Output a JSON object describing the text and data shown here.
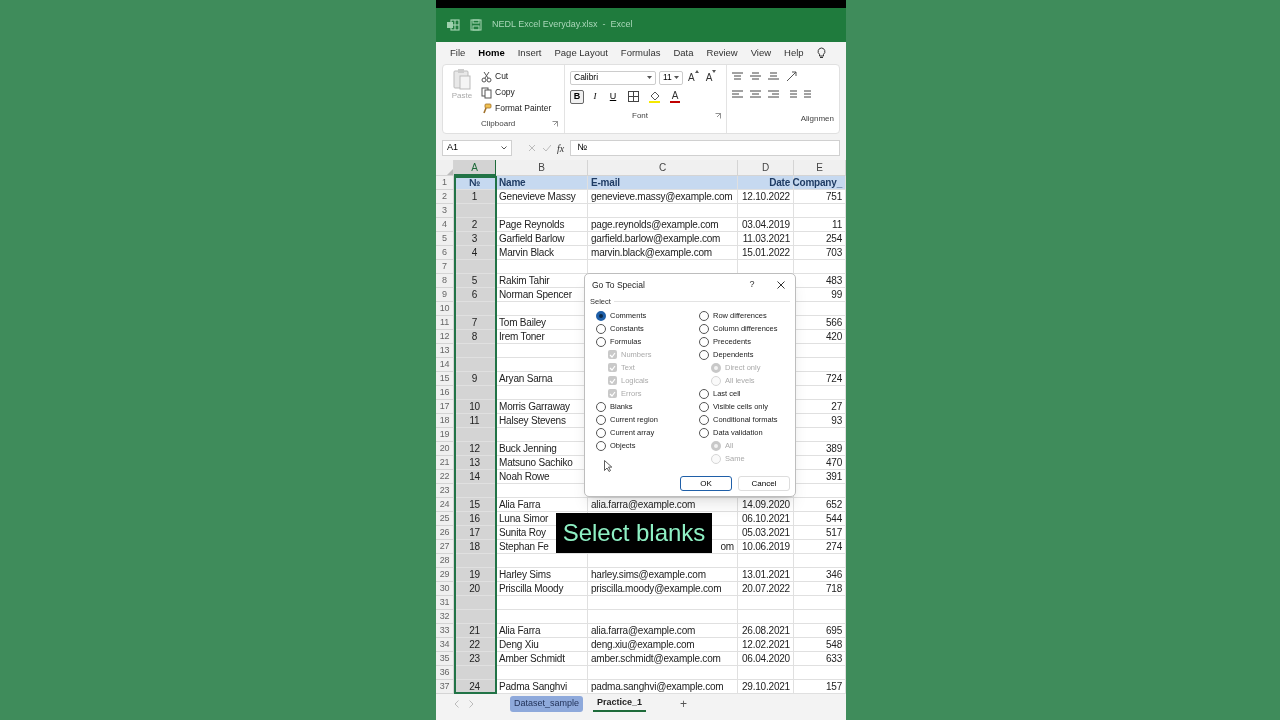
{
  "window": {
    "title": "NEDL Excel Everyday.xlsx  -  Excel"
  },
  "menu": [
    {
      "label": "File",
      "selected": false
    },
    {
      "label": "Home",
      "selected": true
    },
    {
      "label": "Insert",
      "selected": false
    },
    {
      "label": "Page Layout",
      "selected": false
    },
    {
      "label": "Formulas",
      "selected": false
    },
    {
      "label": "Data",
      "selected": false
    },
    {
      "label": "Review",
      "selected": false
    },
    {
      "label": "View",
      "selected": false
    },
    {
      "label": "Help",
      "selected": false
    }
  ],
  "ribbon": {
    "clipboard": {
      "paste": {
        "label": "Paste",
        "disabled": true
      },
      "items": [
        "Cut",
        "Copy",
        "Format Painter"
      ],
      "label": "Clipboard"
    },
    "font": {
      "name": "Calibri",
      "size": "11",
      "size_buttons": [
        "A",
        "A"
      ],
      "styles": [
        {
          "label": "B",
          "selected": true
        },
        {
          "label": "I",
          "selected": false
        },
        {
          "label": "U",
          "selected": false
        }
      ],
      "font_color": "A",
      "label": "Font"
    },
    "alignment": {
      "label": "Alignmen"
    }
  },
  "formula_bar": {
    "name_box": "A1",
    "fx": "fx",
    "value": "№"
  },
  "columns": [
    {
      "label": "A",
      "selected": true
    },
    {
      "label": "B",
      "selected": false
    },
    {
      "label": "C",
      "selected": false
    },
    {
      "label": "D",
      "selected": false
    },
    {
      "label": "E",
      "selected": false
    }
  ],
  "rows": [
    {
      "n": "1",
      "kind": "header",
      "a": "№",
      "b": "Name",
      "c": "E-mail",
      "d": "Date",
      "e": "Company_"
    },
    {
      "n": "2",
      "a": "1",
      "b": "Genevieve Massy",
      "c": "genevieve.massy@example.com",
      "d": "12.10.2022",
      "e": "751"
    },
    {
      "n": "3"
    },
    {
      "n": "4",
      "a": "2",
      "b": "Page Reynolds",
      "c": "page.reynolds@example.com",
      "d": "03.04.2019",
      "e": "11"
    },
    {
      "n": "5",
      "a": "3",
      "b": "Garfield Barlow",
      "c": "garfield.barlow@example.com",
      "d": "11.03.2021",
      "e": "254"
    },
    {
      "n": "6",
      "a": "4",
      "b": "Marvin Black",
      "c": "marvin.black@example.com",
      "d": "15.01.2022",
      "e": "703"
    },
    {
      "n": "7"
    },
    {
      "n": "8",
      "a": "5",
      "b": "Rakim Tahir",
      "e": "483"
    },
    {
      "n": "9",
      "a": "6",
      "b": "Norman Spencer",
      "e": "99"
    },
    {
      "n": "10"
    },
    {
      "n": "11",
      "a": "7",
      "b": "Tom Bailey",
      "e": "566"
    },
    {
      "n": "12",
      "a": "8",
      "b": "Irem Toner",
      "e": "420"
    },
    {
      "n": "13"
    },
    {
      "n": "14"
    },
    {
      "n": "15",
      "a": "9",
      "b": "Aryan Sarna",
      "e": "724"
    },
    {
      "n": "16"
    },
    {
      "n": "17",
      "a": "10",
      "b": "Morris Garraway",
      "e": "27"
    },
    {
      "n": "18",
      "a": "11",
      "b": "Halsey Stevens",
      "e": "93"
    },
    {
      "n": "19"
    },
    {
      "n": "20",
      "a": "12",
      "b": "Buck Jenning",
      "e": "389"
    },
    {
      "n": "21",
      "a": "13",
      "b": "Matsuno Sachiko",
      "e": "470"
    },
    {
      "n": "22",
      "a": "14",
      "b": "Noah Rowe",
      "e": "391"
    },
    {
      "n": "23"
    },
    {
      "n": "24",
      "a": "15",
      "b": "Alia Farra",
      "c": "alia.farra@example.com",
      "d": "14.09.2020",
      "e": "652"
    },
    {
      "n": "25",
      "a": "16",
      "b": "Luna Simor",
      "d": "06.10.2021",
      "e": "544"
    },
    {
      "n": "26",
      "a": "17",
      "b": "Sunita Roy",
      "d": "05.03.2021",
      "e": "517"
    },
    {
      "n": "27",
      "a": "18",
      "b": "Stephan Fe",
      "c": "om",
      "c_cut_left": true,
      "d": "10.06.2019",
      "e": "274"
    },
    {
      "n": "28"
    },
    {
      "n": "29",
      "a": "19",
      "b": "Harley Sims",
      "c": "harley.sims@example.com",
      "d": "13.01.2021",
      "e": "346"
    },
    {
      "n": "30",
      "a": "20",
      "b": "Priscilla Moody",
      "c": "priscilla.moody@example.com",
      "d": "20.07.2022",
      "e": "718"
    },
    {
      "n": "31"
    },
    {
      "n": "32"
    },
    {
      "n": "33",
      "a": "21",
      "b": "Alia Farra",
      "c": "alia.farra@example.com",
      "d": "26.08.2021",
      "e": "695"
    },
    {
      "n": "34",
      "a": "22",
      "b": "Deng Xiu",
      "c": "deng.xiu@example.com",
      "d": "12.02.2021",
      "e": "548"
    },
    {
      "n": "35",
      "a": "23",
      "b": "Amber Schmidt",
      "c": "amber.schmidt@example.com",
      "d": "06.04.2020",
      "e": "633"
    },
    {
      "n": "36"
    },
    {
      "n": "37",
      "a": "24",
      "b": "Padma Sanghvi",
      "c": "padma.sanghvi@example.com",
      "d": "29.10.2021",
      "e": "157"
    }
  ],
  "dialog": {
    "title": "Go To Special",
    "help": "?",
    "group": "Select",
    "left": [
      {
        "kind": "radio",
        "label": "Comments",
        "selected": true
      },
      {
        "kind": "radio",
        "label": "Constants",
        "selected": false
      },
      {
        "kind": "radio",
        "label": "Formulas",
        "selected": false,
        "children": [
          {
            "kind": "checkbox",
            "label": "Numbers",
            "checked": true,
            "disabled": true
          },
          {
            "kind": "checkbox",
            "label": "Text",
            "checked": true,
            "disabled": true
          },
          {
            "kind": "checkbox",
            "label": "Logicals",
            "checked": true,
            "disabled": true
          },
          {
            "kind": "checkbox",
            "label": "Errors",
            "checked": true,
            "disabled": true
          }
        ]
      },
      {
        "kind": "radio",
        "label": "Blanks",
        "selected": false
      },
      {
        "kind": "radio",
        "label": "Current region",
        "selected": false
      },
      {
        "kind": "radio",
        "label": "Current array",
        "selected": false
      },
      {
        "kind": "radio",
        "label": "Objects",
        "selected": false
      }
    ],
    "right": [
      {
        "kind": "radio",
        "label": "Row differences",
        "selected": false
      },
      {
        "kind": "radio",
        "label": "Column differences",
        "selected": false
      },
      {
        "kind": "radio",
        "label": "Precedents",
        "selected": false
      },
      {
        "kind": "radio",
        "label": "Dependents",
        "selected": false,
        "children": [
          {
            "kind": "radio",
            "label": "Direct only",
            "selected": true,
            "disabled": true
          },
          {
            "kind": "radio",
            "label": "All levels",
            "selected": false,
            "disabled": true
          }
        ]
      },
      {
        "kind": "radio",
        "label": "Last cell",
        "selected": false
      },
      {
        "kind": "radio",
        "label": "Visible cells only",
        "selected": false
      },
      {
        "kind": "radio",
        "label": "Conditional formats",
        "selected": false
      },
      {
        "kind": "radio",
        "label": "Data validation",
        "selected": false,
        "children": [
          {
            "kind": "radio",
            "label": "All",
            "selected": true,
            "disabled": true
          },
          {
            "kind": "radio",
            "label": "Same",
            "selected": false,
            "disabled": true
          }
        ]
      }
    ],
    "buttons": [
      {
        "label": "OK",
        "default": true
      },
      {
        "label": "Cancel",
        "default": false
      }
    ]
  },
  "caption": "Select blanks",
  "sheet_tabs": [
    {
      "label": "Dataset_sample",
      "selected": false
    },
    {
      "label": "Practice_1",
      "selected": true
    }
  ],
  "add_sheet": "+"
}
